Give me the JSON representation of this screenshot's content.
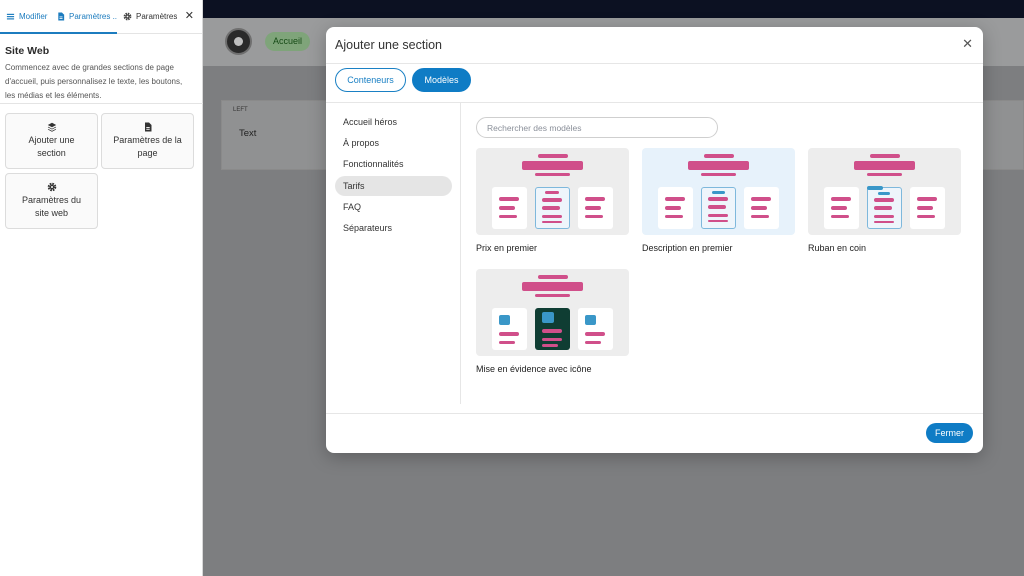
{
  "left_panel": {
    "tabs": [
      {
        "label": "Modifier",
        "icon": "menu-icon"
      },
      {
        "label": "Paramètres ...",
        "icon": "document-icon"
      },
      {
        "label": "Paramètres ...",
        "icon": "gear-icon"
      }
    ],
    "close_label": "✕",
    "title": "Site Web",
    "description": "Commencez avec de grandes sections de page d'accueil, puis personnalisez le texte, les boutons, les médias et les éléments.",
    "cards": [
      {
        "label": "Ajouter une section",
        "icon": "layers-icon"
      },
      {
        "label": "Paramètres de la page",
        "icon": "document-icon"
      },
      {
        "label": "Paramètres du site web",
        "icon": "gear-icon"
      }
    ]
  },
  "site_preview": {
    "nav_pill": "Accueil",
    "section_label": "LEFT",
    "section_text": "Text"
  },
  "modal": {
    "title": "Ajouter une section",
    "close_label": "✕",
    "tabs": [
      {
        "label": "Conteneurs",
        "active": false
      },
      {
        "label": "Modèles",
        "active": true
      }
    ],
    "categories": [
      {
        "label": "Accueil héros",
        "active": false
      },
      {
        "label": "À propos",
        "active": false
      },
      {
        "label": "Fonctionnalités",
        "active": false
      },
      {
        "label": "Tarifs",
        "active": true
      },
      {
        "label": "FAQ",
        "active": false
      },
      {
        "label": "Séparateurs",
        "active": false
      }
    ],
    "search_placeholder": "Rechercher des modèles",
    "templates": [
      {
        "label": "Prix en premier"
      },
      {
        "label": "Description en premier"
      },
      {
        "label": "Ruban en coin"
      },
      {
        "label": "Mise en évidence avec icône"
      }
    ],
    "close_button": "Fermer"
  },
  "colors": {
    "accent": "#0f7cc5",
    "thumb_pink": "#d04f8a",
    "thumb_blue": "#3a97c8",
    "thumb_dark": "#0f3d33",
    "overlay": "#7d7e80"
  }
}
